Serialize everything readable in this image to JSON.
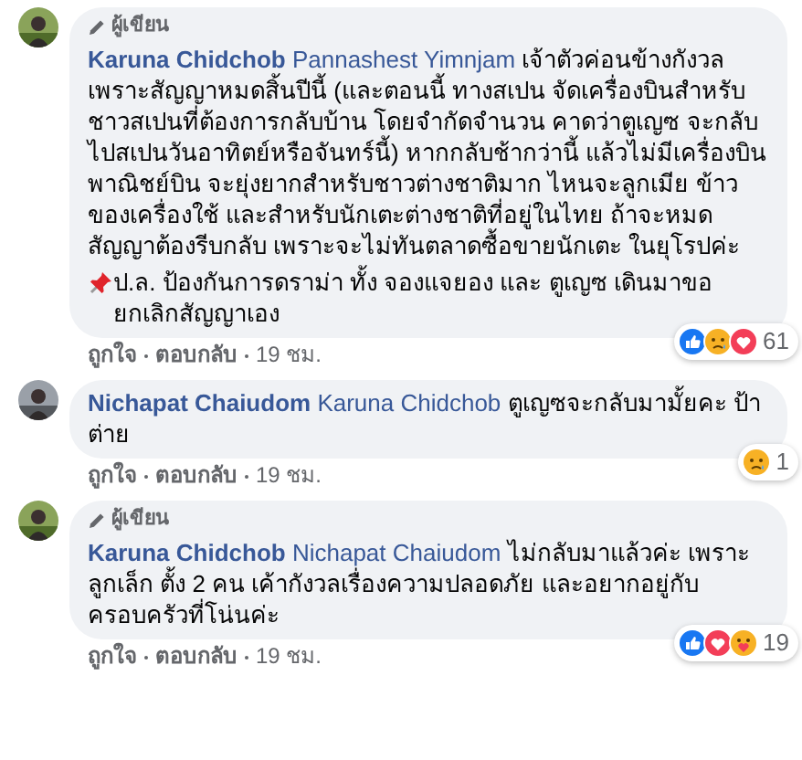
{
  "comments": [
    {
      "badge": "ผู้เขียน",
      "author": "Karuna Chidchob",
      "mention": "Pannashest Yimnjam",
      "paragraphs": [
        {
          "kind": "text",
          "text": "เจ้าตัวค่อนข้างกังวล เพราะสัญญาหมดสิ้นปีนี้ (และตอนนี้ ทางสเปน จัดเครื่องบินสำหรับชาวสเปนที่ต้องการกลับบ้าน โดยจำกัดจำนวน คาดว่าตูเญซ จะกลับไปสเปนวันอาทิตย์หรือจันทร์นี้) หากกลับช้ากว่านี้ แล้วไม่มีเครื่องบินพาณิชย์บิน จะยุ่งยากสำหรับชาวต่างชาติมาก ไหนจะลูกเมีย ข้าวของเครื่องใช้ และสำหรับนักเตะต่างชาติที่อยู่ในไทย ถ้าจะหมดสัญญาต้องรีบกลับ เพราะจะไม่ทันตลาดซื้อขายนักเตะ ในยุโรปค่ะ"
        },
        {
          "kind": "note",
          "text": "ป.ล. ป้องกันการดราม่า ทั้ง จองแจยอง และ ตูเญซ เดินมาขอยกเลิกสัญญาเอง"
        }
      ],
      "reactions": [
        {
          "kind": "like"
        },
        {
          "kind": "sad"
        },
        {
          "kind": "love"
        }
      ],
      "reaction_count": "61",
      "actions": [
        "ถูกใจ",
        "ตอบกลับ",
        "19 ชม."
      ]
    },
    {
      "author": "Nichapat Chaiudom",
      "mention": "Karuna Chidchob",
      "paragraphs": [
        {
          "kind": "text",
          "text": "ตูเญซจะกลับมามั้ยคะ ป้าต่าย"
        }
      ],
      "reactions": [
        {
          "kind": "sad"
        }
      ],
      "reaction_count": "1",
      "actions": [
        "ถูกใจ",
        "ตอบกลับ",
        "19 ชม."
      ]
    },
    {
      "badge": "ผู้เขียน",
      "author": "Karuna Chidchob",
      "mention": "Nichapat Chaiudom",
      "paragraphs": [
        {
          "kind": "text",
          "text": "ไม่กลับมาแล้วค่ะ เพราะลูกเล็ก ตั้ง 2 คน เค้ากังวลเรื่องความปลอดภัย และอยากอยู่กับครอบครัวที่โน่นค่ะ"
        }
      ],
      "reactions": [
        {
          "kind": "like"
        },
        {
          "kind": "love"
        },
        {
          "kind": "care"
        }
      ],
      "reaction_count": "19",
      "actions": [
        "ถูกใจ",
        "ตอบกลับ",
        "19 ชม."
      ]
    }
  ]
}
